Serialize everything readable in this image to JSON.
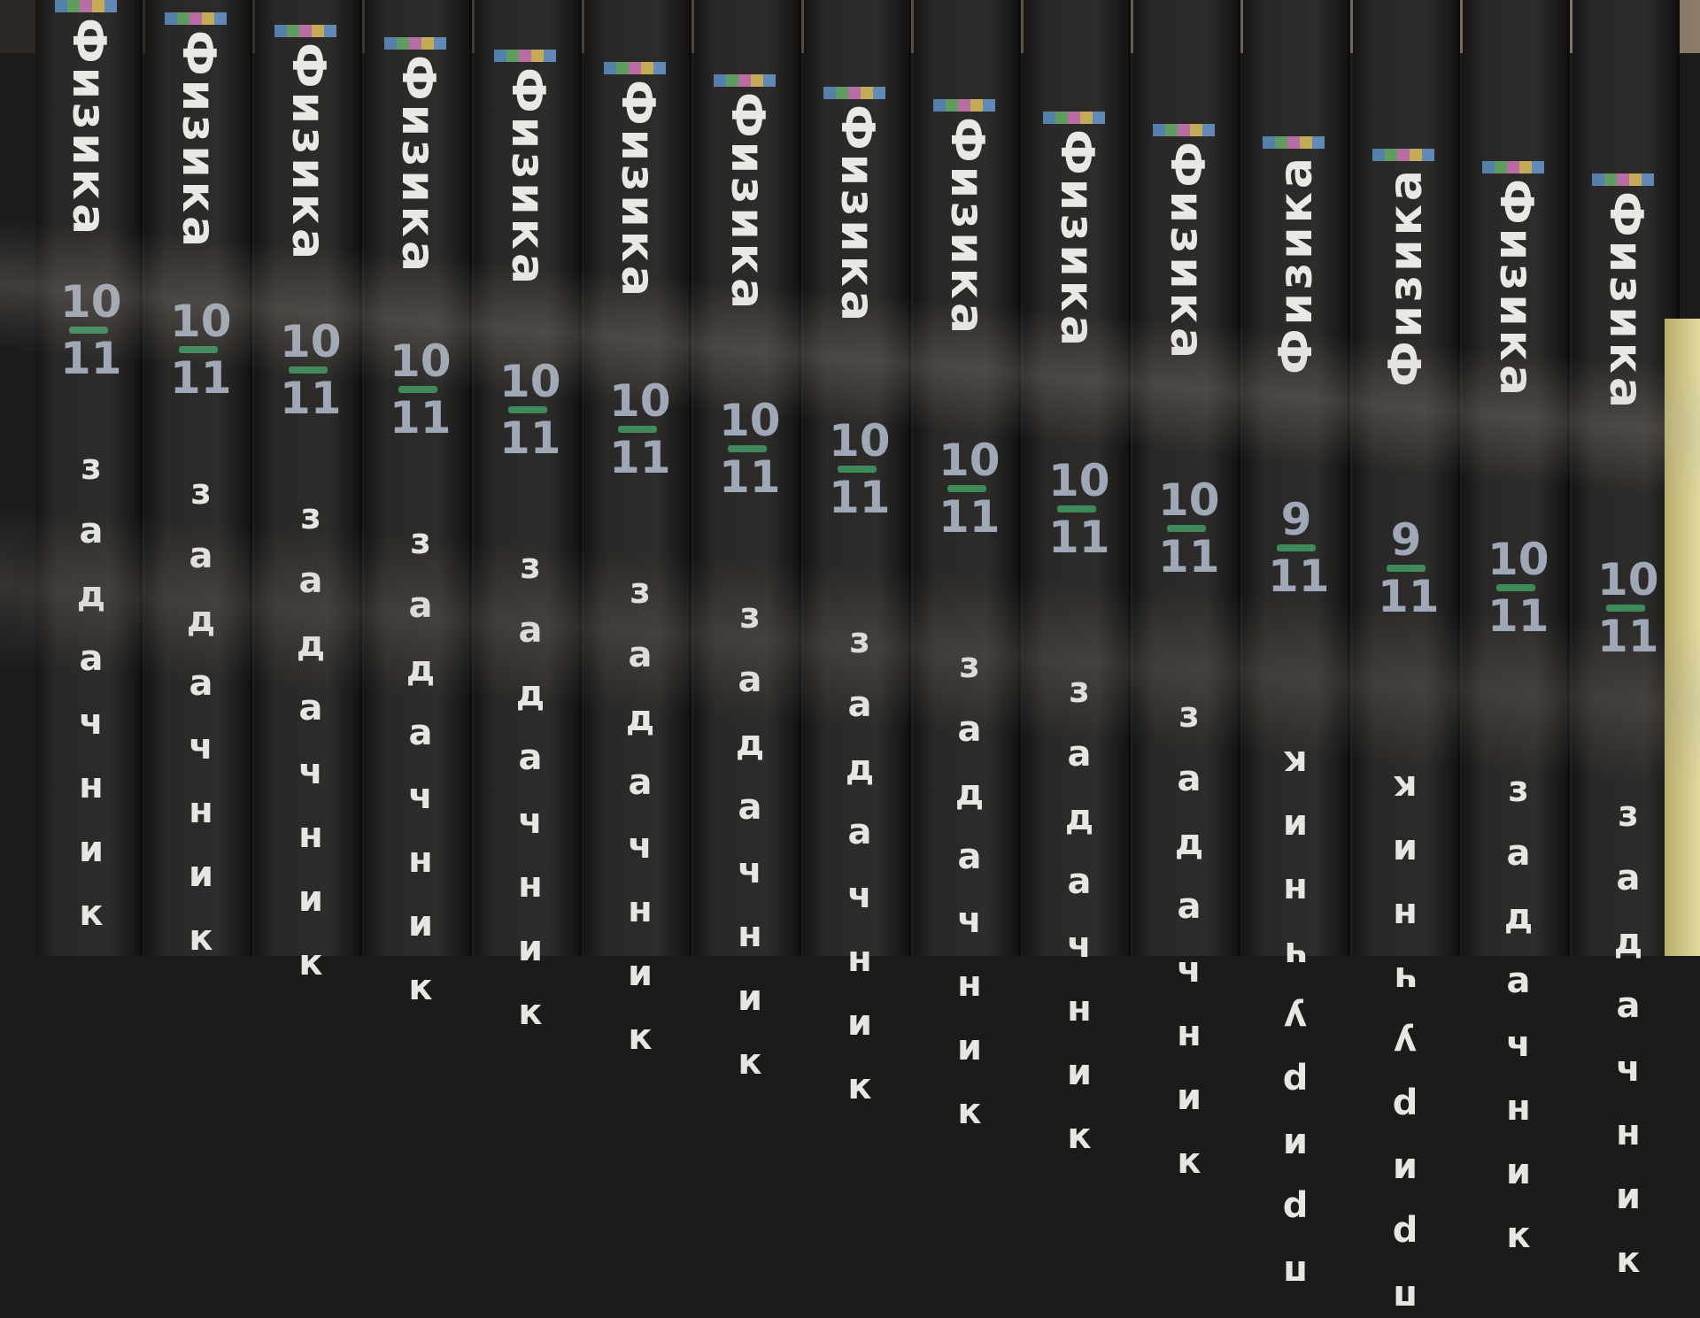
{
  "photo": {
    "subject": "book spines on a shelf",
    "spine_color": "#2a2826",
    "accent_colors": [
      "#3f8a5a",
      "#9ea8b6"
    ],
    "spines": [
      {
        "title": "Физика",
        "grade_top": "10",
        "grade_bottom": "11",
        "subtitle": "задачник",
        "inverted": false
      },
      {
        "title": "Физика",
        "grade_top": "10",
        "grade_bottom": "11",
        "subtitle": "задачник",
        "inverted": false
      },
      {
        "title": "Физика",
        "grade_top": "10",
        "grade_bottom": "11",
        "subtitle": "задачник",
        "inverted": false
      },
      {
        "title": "Физика",
        "grade_top": "10",
        "grade_bottom": "11",
        "subtitle": "задачник",
        "inverted": false
      },
      {
        "title": "Физика",
        "grade_top": "10",
        "grade_bottom": "11",
        "subtitle": "задачник",
        "inverted": false
      },
      {
        "title": "Физика",
        "grade_top": "10",
        "grade_bottom": "11",
        "subtitle": "задачник",
        "inverted": false
      },
      {
        "title": "Физика",
        "grade_top": "10",
        "grade_bottom": "11",
        "subtitle": "задачник",
        "inverted": false
      },
      {
        "title": "Физика",
        "grade_top": "10",
        "grade_bottom": "11",
        "subtitle": "задачник",
        "inverted": false
      },
      {
        "title": "Физика",
        "grade_top": "10",
        "grade_bottom": "11",
        "subtitle": "задачник",
        "inverted": false
      },
      {
        "title": "Физика",
        "grade_top": "10",
        "grade_bottom": "11",
        "subtitle": "задачник",
        "inverted": false
      },
      {
        "title": "Физика",
        "grade_top": "10",
        "grade_bottom": "11",
        "subtitle": "задачник",
        "inverted": false
      },
      {
        "title": "Физика",
        "grade_top": "9",
        "grade_bottom": "11",
        "subtitle": "приручник",
        "inverted": true
      },
      {
        "title": "Физика",
        "grade_top": "9",
        "grade_bottom": "11",
        "subtitle": "приручник",
        "inverted": true
      },
      {
        "title": "Физика",
        "grade_top": "10",
        "grade_bottom": "11",
        "subtitle": "задачник",
        "inverted": false
      },
      {
        "title": "Физика",
        "grade_top": "10",
        "grade_bottom": "11",
        "subtitle": "задачник",
        "inverted": false
      }
    ]
  }
}
